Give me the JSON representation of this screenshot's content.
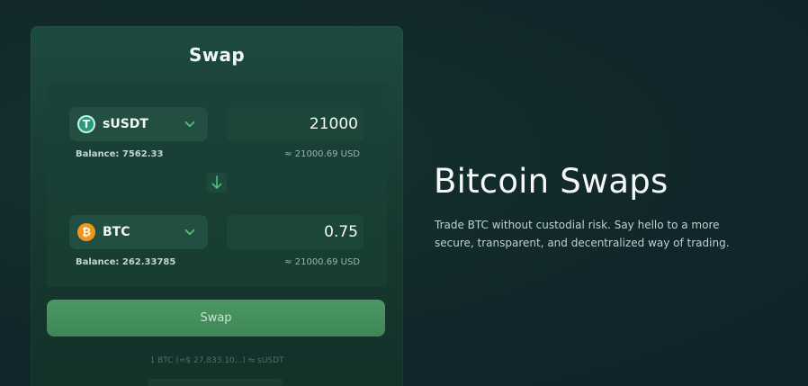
{
  "card": {
    "title": "Swap",
    "from": {
      "token": "sUSDT",
      "amount": "21000",
      "balance": "Balance: 7562.33",
      "usd": "≈ 21000.69 USD"
    },
    "to": {
      "token": "BTC",
      "amount": "0.75",
      "balance": "Balance: 262.33785",
      "usd": "≈ 21000.69 USD"
    },
    "swap_label": "Swap",
    "rate_text": "1 BTC (≈$ 27,833.10...) ⇋ sUSDT"
  },
  "hero": {
    "title": "Bitcoin Swaps",
    "description": "Trade BTC without custodial risk. Say hello to a more secure, transparent, and decentralized way of trading."
  },
  "icons": {
    "usdt": "tether-icon",
    "btc": "bitcoin-icon",
    "chevron": "chevron-down-icon",
    "arrow": "arrow-down-icon"
  },
  "colors": {
    "accent": "#4c9865",
    "chevron": "#4fbf7a",
    "background": "#11262a"
  }
}
